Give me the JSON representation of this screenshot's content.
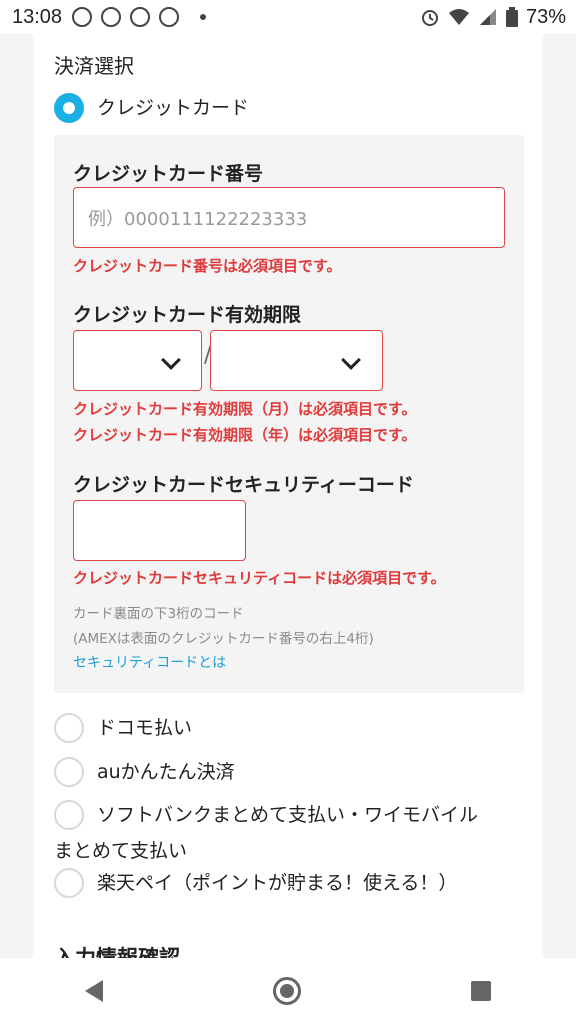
{
  "status_bar": {
    "time": "13:08",
    "battery": "73%"
  },
  "payment": {
    "title": "決済選択",
    "credit_option": "クレジットカード",
    "card_number_label": "クレジットカード番号",
    "card_number_placeholder": "例）0000111122223333",
    "card_number_error": "クレジットカード番号は必須項目です。",
    "expiry_label": "クレジットカード有効期限",
    "expiry_separator": "/",
    "expiry_month_error": "クレジットカード有効期限（月）は必須項目です。",
    "expiry_year_error": "クレジットカード有効期限（年）は必須項目です。",
    "security_label": "クレジットカードセキュリティーコード",
    "security_error": "クレジットカードセキュリティコードは必須項目です。",
    "security_note_1": "カード裏面の下3桁のコード",
    "security_note_2": "(AMEXは表面のクレジットカード番号の右上4桁)",
    "security_link": "セキュリティコードとは",
    "other_options": [
      "ドコモ払い",
      "auかんたん決済",
      "ソフトバンクまとめて支払い・ワイモバイル",
      "楽天ペイ（ポイントが貯まる！使える！）"
    ],
    "softbank_continuation": "まとめて支払い"
  },
  "next_section_heading": "入力情報確認",
  "colors": {
    "accent": "#1ab0e6",
    "error": "#e03a3a",
    "link": "#1aa0d8"
  }
}
